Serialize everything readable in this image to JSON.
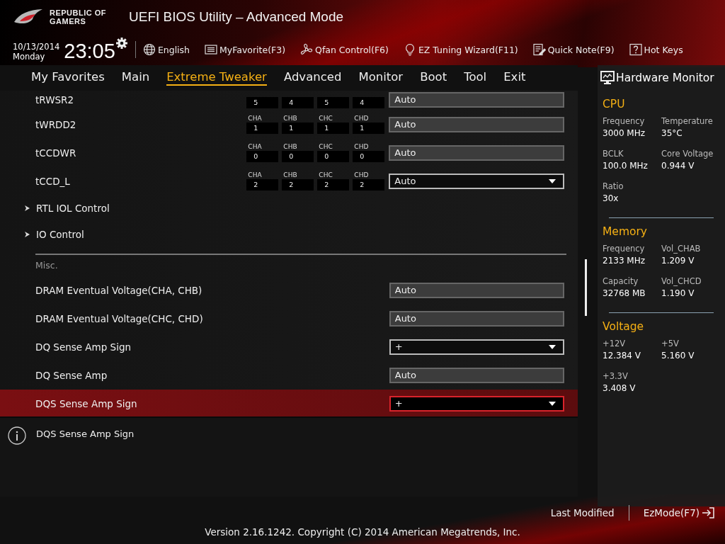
{
  "header": {
    "logo_text": "REPUBLIC OF\nGAMERS",
    "title": "UEFI BIOS Utility – Advanced Mode"
  },
  "toolbar": {
    "date": "10/13/2014",
    "day": "Monday",
    "time": "23:05",
    "items": [
      {
        "label": "English"
      },
      {
        "label": "MyFavorite(F3)"
      },
      {
        "label": "Qfan Control(F6)"
      },
      {
        "label": "EZ Tuning Wizard(F11)"
      },
      {
        "label": "Quick Note(F9)"
      },
      {
        "label": "Hot Keys"
      }
    ]
  },
  "tabs": [
    {
      "label": "My Favorites",
      "selected": false
    },
    {
      "label": "Main",
      "selected": false
    },
    {
      "label": "Extreme Tweaker",
      "selected": true
    },
    {
      "label": "Advanced",
      "selected": false
    },
    {
      "label": "Monitor",
      "selected": false
    },
    {
      "label": "Boot",
      "selected": false
    },
    {
      "label": "Tool",
      "selected": false
    },
    {
      "label": "Exit",
      "selected": false
    }
  ],
  "settings": [
    {
      "kind": "timing",
      "name": "tRWSR2",
      "channels": [
        {
          "value": "5"
        },
        {
          "value": "4"
        },
        {
          "value": "5"
        },
        {
          "value": "4"
        }
      ],
      "value": "Auto",
      "dropdown": false,
      "selected": false
    },
    {
      "kind": "timing",
      "name": "tWRDD2",
      "channels": [
        {
          "label": "CHA",
          "value": "1"
        },
        {
          "label": "CHB",
          "value": "1"
        },
        {
          "label": "CHC",
          "value": "1"
        },
        {
          "label": "CHD",
          "value": "1"
        }
      ],
      "value": "Auto",
      "dropdown": false,
      "selected": false
    },
    {
      "kind": "timing",
      "name": "tCCDWR",
      "channels": [
        {
          "label": "CHA",
          "value": "0"
        },
        {
          "label": "CHB",
          "value": "0"
        },
        {
          "label": "CHC",
          "value": "0"
        },
        {
          "label": "CHD",
          "value": "0"
        }
      ],
      "value": "Auto",
      "dropdown": false,
      "selected": false
    },
    {
      "kind": "timing",
      "name": "tCCD_L",
      "channels": [
        {
          "label": "CHA",
          "value": "2"
        },
        {
          "label": "CHB",
          "value": "2"
        },
        {
          "label": "CHC",
          "value": "2"
        },
        {
          "label": "CHD",
          "value": "2"
        }
      ],
      "value": "Auto",
      "dropdown": true,
      "selected": false
    },
    {
      "kind": "submenu",
      "name": "RTL IOL Control"
    },
    {
      "kind": "submenu",
      "name": "IO Control"
    },
    {
      "kind": "section",
      "name": "Misc."
    },
    {
      "kind": "setting",
      "name": "DRAM Eventual Voltage(CHA, CHB)",
      "value": "Auto",
      "dropdown": false,
      "selected": false
    },
    {
      "kind": "setting",
      "name": "DRAM Eventual Voltage(CHC, CHD)",
      "value": "Auto",
      "dropdown": false,
      "selected": false
    },
    {
      "kind": "setting",
      "name": "DQ Sense Amp Sign",
      "value": "+",
      "dropdown": true,
      "selected": false
    },
    {
      "kind": "setting",
      "name": "DQ Sense Amp",
      "value": "Auto",
      "dropdown": false,
      "selected": false
    },
    {
      "kind": "setting",
      "name": "DQS Sense Amp Sign",
      "value": "+",
      "dropdown": true,
      "selected": true
    }
  ],
  "help": {
    "text": "DQS Sense Amp Sign"
  },
  "hardware_monitor": {
    "title": "Hardware Monitor",
    "sections": [
      {
        "title": "CPU",
        "items": [
          {
            "label": "Frequency",
            "value": "3000 MHz"
          },
          {
            "label": "Temperature",
            "value": "35°C"
          },
          {
            "label": "BCLK",
            "value": "100.0 MHz"
          },
          {
            "label": "Core Voltage",
            "value": "0.944 V"
          },
          {
            "label": "Ratio",
            "value": "30x"
          }
        ]
      },
      {
        "title": "Memory",
        "items": [
          {
            "label": "Frequency",
            "value": "2133 MHz"
          },
          {
            "label": "Vol_CHAB",
            "value": "1.209 V"
          },
          {
            "label": "Capacity",
            "value": "32768 MB"
          },
          {
            "label": "Vol_CHCD",
            "value": "1.190 V"
          }
        ]
      },
      {
        "title": "Voltage",
        "items": [
          {
            "label": "+12V",
            "value": "12.384 V"
          },
          {
            "label": "+5V",
            "value": "5.160 V"
          },
          {
            "label": "+3.3V",
            "value": "3.408 V"
          }
        ]
      }
    ]
  },
  "footer": {
    "last_modified": "Last Modified",
    "ez_mode": "EzMode(F7)",
    "version": "Version 2.16.1242. Copyright (C) 2014 American Megatrends, Inc."
  }
}
